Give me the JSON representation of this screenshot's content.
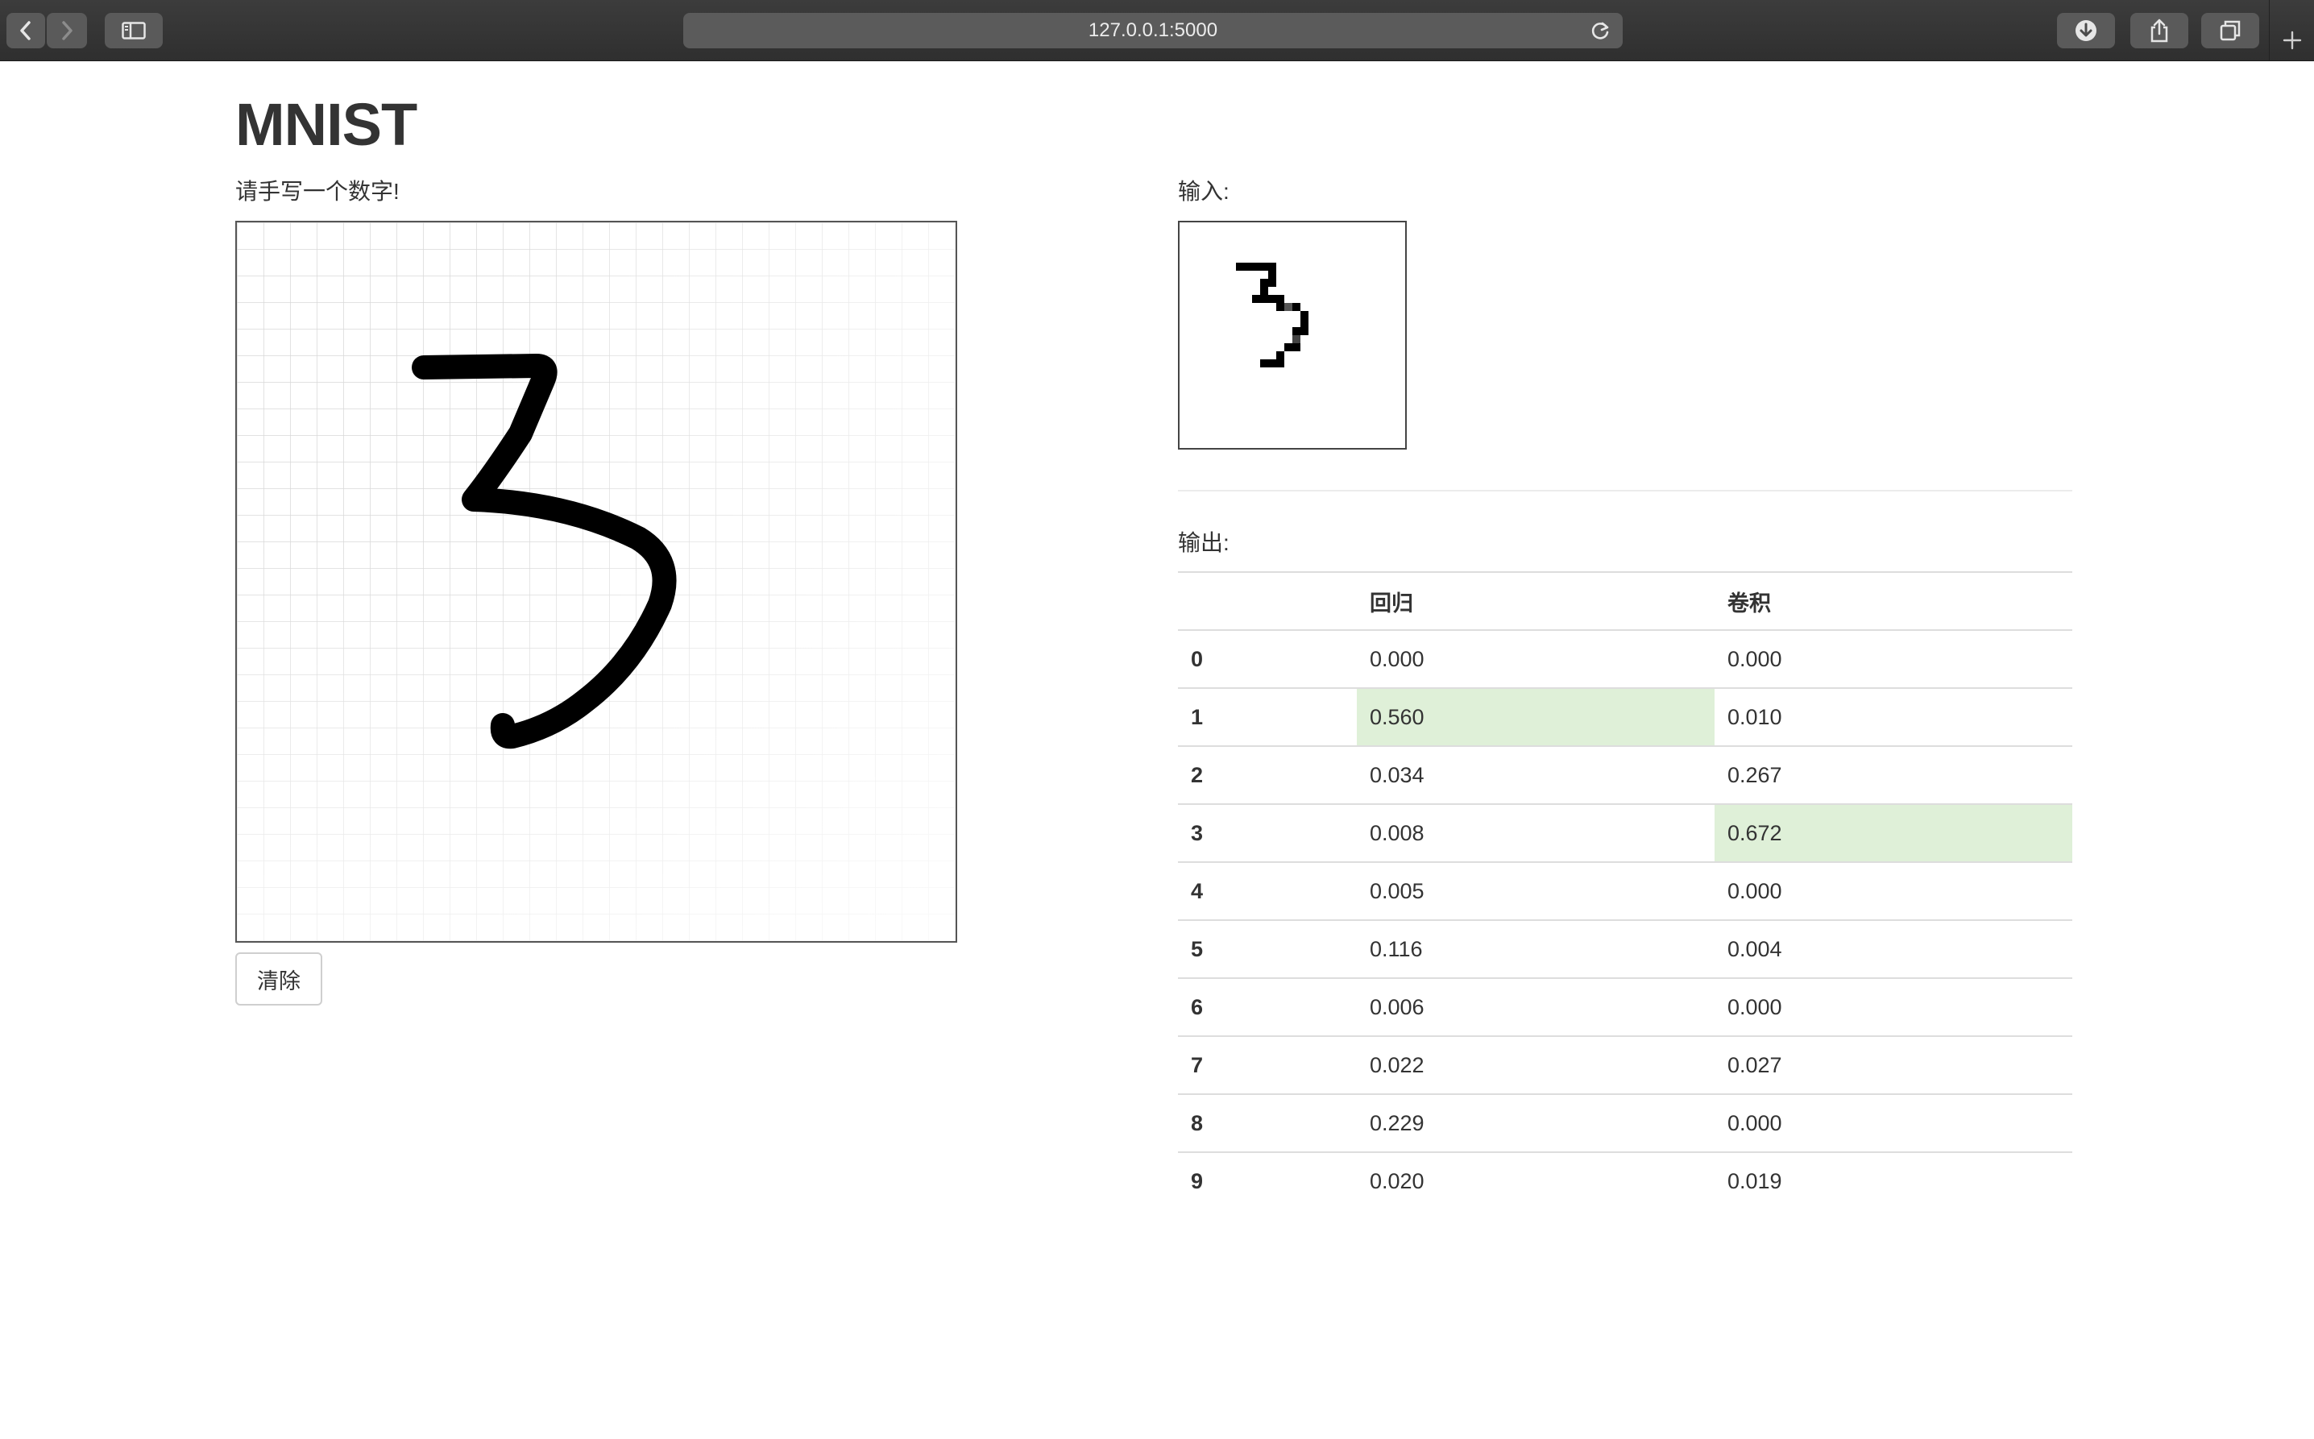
{
  "browser": {
    "url": "127.0.0.1:5000"
  },
  "page": {
    "title": "MNIST",
    "prompt": "请手写一个数字!",
    "clear_button": "清除",
    "input_label": "输入:",
    "output_label": "输出:"
  },
  "results": {
    "headers": [
      "",
      "回归",
      "卷积"
    ],
    "rows": [
      {
        "digit": "0",
        "regression": "0.000",
        "convolution": "0.000"
      },
      {
        "digit": "1",
        "regression": "0.560",
        "convolution": "0.010"
      },
      {
        "digit": "2",
        "regression": "0.034",
        "convolution": "0.267"
      },
      {
        "digit": "3",
        "regression": "0.008",
        "convolution": "0.672"
      },
      {
        "digit": "4",
        "regression": "0.005",
        "convolution": "0.000"
      },
      {
        "digit": "5",
        "regression": "0.116",
        "convolution": "0.004"
      },
      {
        "digit": "6",
        "regression": "0.006",
        "convolution": "0.000"
      },
      {
        "digit": "7",
        "regression": "0.022",
        "convolution": "0.027"
      },
      {
        "digit": "8",
        "regression": "0.229",
        "convolution": "0.000"
      },
      {
        "digit": "9",
        "regression": "0.020",
        "convolution": "0.019"
      }
    ],
    "highlight_regression_row": 1,
    "highlight_convolution_row": 3,
    "highlight_color": "#dff0d8"
  }
}
